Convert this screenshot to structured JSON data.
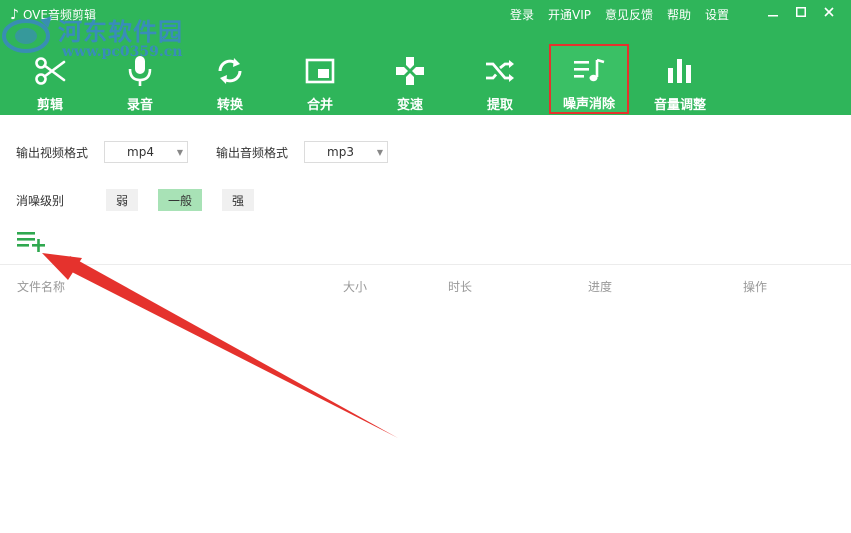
{
  "app": {
    "title": "OVE音频剪辑"
  },
  "watermark": {
    "name": "河东软件园",
    "url": "www.pc0359.cn"
  },
  "top_links": [
    "登录",
    "开通VIP",
    "意见反馈",
    "帮助",
    "设置"
  ],
  "toolbar": {
    "tools": [
      {
        "label": "剪辑",
        "icon": "scissors-icon"
      },
      {
        "label": "录音",
        "icon": "microphone-icon"
      },
      {
        "label": "转换",
        "icon": "convert-icon"
      },
      {
        "label": "合并",
        "icon": "merge-icon"
      },
      {
        "label": "变速",
        "icon": "speed-icon"
      },
      {
        "label": "提取",
        "icon": "extract-icon"
      },
      {
        "label": "噪声消除",
        "icon": "noise-removal-icon",
        "active": true
      },
      {
        "label": "音量调整",
        "icon": "volume-bars-icon"
      }
    ]
  },
  "form": {
    "video_format_label": "输出视频格式",
    "video_format_value": "mp4",
    "audio_format_label": "输出音频格式",
    "audio_format_value": "mp3",
    "noise_level_label": "消噪级别",
    "levels": [
      "弱",
      "一般",
      "强"
    ],
    "selected_level": "一般"
  },
  "table": {
    "columns": [
      "文件名称",
      "大小",
      "时长",
      "进度",
      "操作"
    ]
  },
  "colors": {
    "header": "#2fb55a",
    "active_border": "#e5322d",
    "selected_level": "#a8e2b6",
    "arrow": "#e5322d"
  }
}
